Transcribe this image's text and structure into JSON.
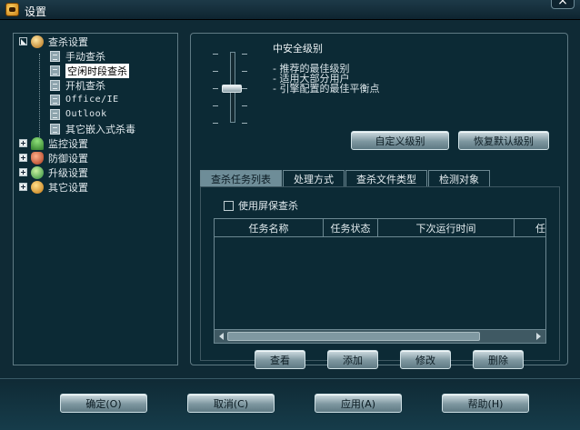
{
  "window": {
    "title": "设置",
    "close_label": "×"
  },
  "tree": {
    "groups": [
      {
        "label": "查杀设置",
        "expanded": true,
        "icon": "antivirus-icon"
      },
      {
        "label": "监控设置",
        "expanded": false,
        "icon": "monitor-umbrella-icon"
      },
      {
        "label": "防御设置",
        "expanded": false,
        "icon": "shield-icon"
      },
      {
        "label": "升级设置",
        "expanded": false,
        "icon": "update-globe-icon"
      },
      {
        "label": "其它设置",
        "expanded": false,
        "icon": "gear-icon"
      }
    ],
    "children": [
      {
        "label": "手动查杀"
      },
      {
        "label": "空闲时段查杀",
        "selected": true
      },
      {
        "label": "开机查杀"
      },
      {
        "label": "Office/IE"
      },
      {
        "label": "Outlook"
      },
      {
        "label": "其它嵌入式杀毒"
      }
    ]
  },
  "security": {
    "level_title": "中安全级别",
    "desc_lines": [
      "- 推荐的最佳级别",
      "- 适用大部分用户",
      "- 引擎配置的最佳平衡点"
    ],
    "level_fraction": 0.5,
    "custom_button": "自定义级别",
    "restore_button": "恢复默认级别"
  },
  "tabs": [
    {
      "label": "查杀任务列表",
      "active": true
    },
    {
      "label": "处理方式"
    },
    {
      "label": "查杀文件类型"
    },
    {
      "label": "检测对象"
    }
  ],
  "screensaver_checkbox": {
    "label": "使用屏保查杀",
    "checked": false
  },
  "task_table": {
    "columns": [
      "任务名称",
      "任务状态",
      "下次运行时间",
      "任"
    ],
    "rows": []
  },
  "task_buttons": [
    "查看",
    "添加",
    "修改",
    "删除"
  ],
  "footer_buttons": [
    "确定(O)",
    "取消(C)",
    "应用(A)",
    "帮助(H)"
  ],
  "colors": {
    "accent": "#6e8d98",
    "background": "#0c2a35",
    "border": "#5f7a84"
  }
}
